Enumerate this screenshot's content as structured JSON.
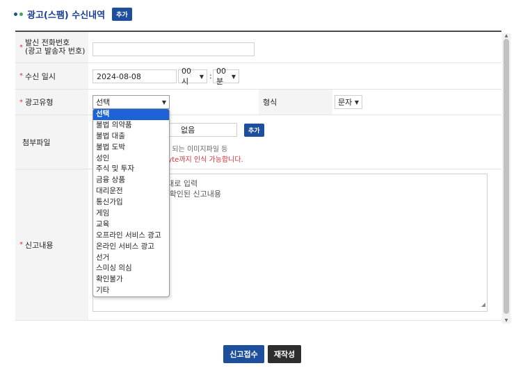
{
  "header": {
    "title": "광고(스팸) 수신내역",
    "add_label": "추가",
    "dot_colors": [
      "#1d4f9c",
      "#3aa655"
    ]
  },
  "form": {
    "sender": {
      "label_line1": "발신 전화번호",
      "label_line2": "(광고 발송자 번호)",
      "value": ""
    },
    "received": {
      "label": "수신 일시",
      "date": "2024-08-08",
      "hour": "00시",
      "separator": ":",
      "minute": "00분"
    },
    "ad_type": {
      "label": "광고유형",
      "selected": "선택",
      "format_label": "형식",
      "format_value": "문자"
    },
    "attachment": {
      "label": "첨부파일",
      "file_value": "없음",
      "add_label": "추가",
      "hint1_visible": "인 되는 이미지파일 등",
      "hint2_visible": "byte까지 인식 가능합니다."
    },
    "content": {
      "label": "신고내용",
      "hint1_visible": "그대로 입력",
      "hint2_visible": "시 확인된 신고내용"
    }
  },
  "dropdown": {
    "options": [
      "선택",
      "불법 의약품",
      "불법 대출",
      "불법 도박",
      "성인",
      "주식 및 투자",
      "금융 상품",
      "대리운전",
      "통신가입",
      "게임",
      "교육",
      "오프라인 서비스 광고",
      "온라인 서비스 광고",
      "선거",
      "스미싱 의심",
      "확인불가",
      "기타"
    ],
    "selected_index": 0
  },
  "actions": {
    "submit_label": "신고접수",
    "rewrite_label": "재작성"
  },
  "colors": {
    "accent": "#1d4f9c",
    "required": "#d8323b",
    "warning_text": "#d8323b",
    "dropdown_highlight": "#1d62d6"
  }
}
